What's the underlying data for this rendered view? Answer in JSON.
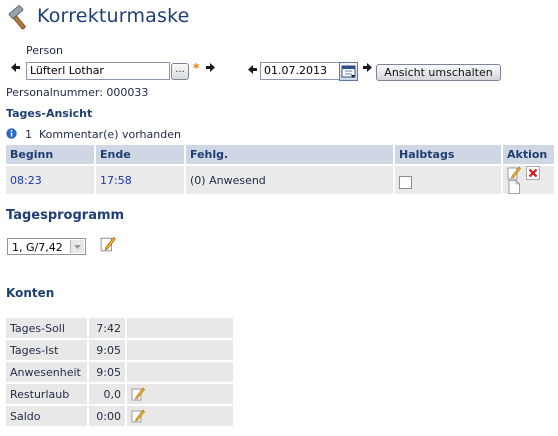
{
  "header": {
    "title": "Korrekturmaske",
    "icon": "hammer-icon"
  },
  "person": {
    "label": "Person",
    "value": "Lüfterl Lothar",
    "lookup_label": "...",
    "required_mark": "*"
  },
  "date": {
    "value": "01.07.2013"
  },
  "switch_button": {
    "label": "Ansicht umschalten"
  },
  "personalnummer": "Personalnummer: 000033",
  "tages_ansicht": {
    "heading": "Tages-Ansicht",
    "comment": "1  Kommentar(e) vorhanden",
    "columns": [
      "Beginn",
      "Ende",
      "Fehlg.",
      "Halbtags",
      "Aktion"
    ],
    "rows": [
      {
        "beginn": "08:23",
        "ende": "17:58",
        "fehlg": "(0) Anwesend",
        "halbtags": false
      }
    ]
  },
  "tagesprogramm": {
    "heading": "Tagesprogramm",
    "selected": "1, G/7,42"
  },
  "konten": {
    "heading": "Konten",
    "rows": [
      {
        "label": "Tages-Soll",
        "value": "7:42",
        "editable": false
      },
      {
        "label": "Tages-Ist",
        "value": "9:05",
        "editable": false
      },
      {
        "label": "Anwesenheit",
        "value": "9:05",
        "editable": false
      },
      {
        "label": "Resturlaub",
        "value": "0,0",
        "editable": true
      },
      {
        "label": "Saldo",
        "value": "0:00",
        "editable": true
      }
    ]
  },
  "colors": {
    "title": "#1f3f73",
    "header_bg": "#cfd6e4",
    "row_bg": "#eaeaea",
    "time_link": "#1a35b8",
    "required": "#e07a10"
  }
}
